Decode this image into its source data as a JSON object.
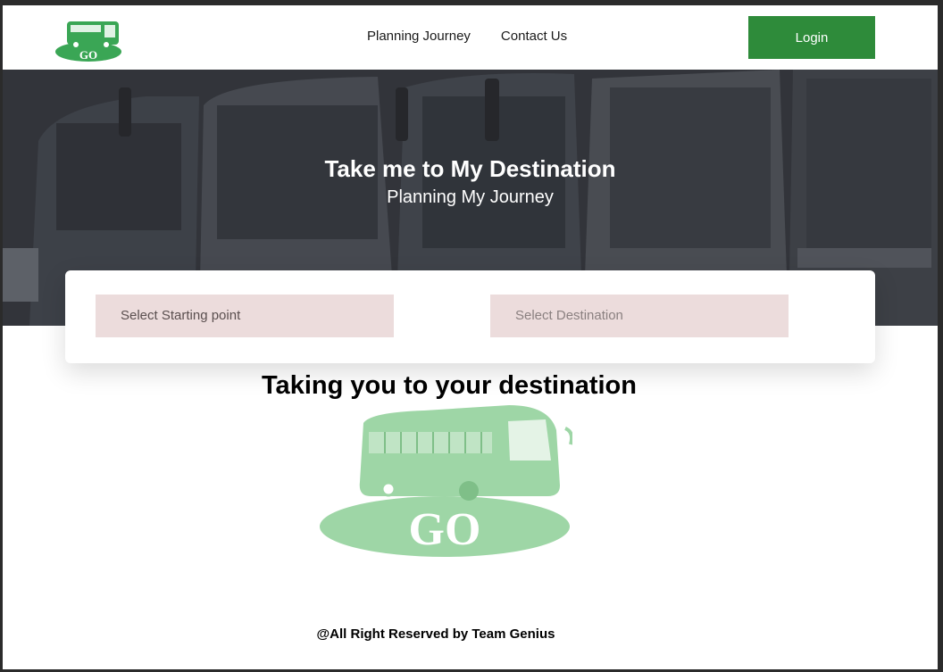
{
  "brand": {
    "logo_text": "GO",
    "logo_color": "#3aa655",
    "big_logo_color": "#9ed6a6"
  },
  "nav": {
    "items": [
      {
        "label": "Planning Journey"
      },
      {
        "label": "Contact Us"
      }
    ]
  },
  "header": {
    "login_label": "Login",
    "login_color": "#2e8b3a"
  },
  "hero": {
    "title": "Take me to My Destination",
    "subtitle": "Planning My Journey"
  },
  "search": {
    "start_placeholder": "Select Starting point",
    "destination_placeholder": "Select Destination",
    "field_color": "#ecdcdc"
  },
  "main": {
    "tagline": "Taking you to your destination"
  },
  "footer": {
    "text": "@All Right Reserved by Team Genius"
  }
}
